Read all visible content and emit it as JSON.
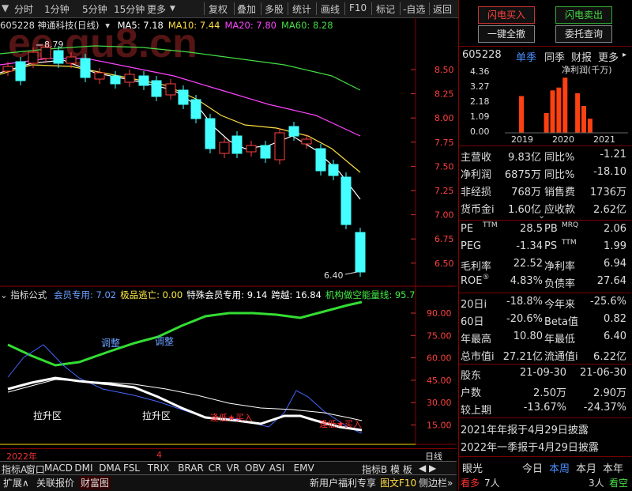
{
  "toolbar": {
    "left": [
      "分时",
      "1分钟",
      "5分钟",
      "15分钟",
      "更多"
    ],
    "right": [
      "复权",
      "叠加",
      "多股",
      "统计",
      "画线",
      "F10",
      "标记",
      "-自选",
      "返回"
    ]
  },
  "stock": {
    "header": "605228 神通科技(日线)",
    "ma": [
      {
        "label": "MA5: 7.18",
        "color": "#ffffff"
      },
      {
        "label": "MA10: 7.44",
        "color": "#ffdd44"
      },
      {
        "label": "MA20: 7.80",
        "color": "#ff44ff"
      },
      {
        "label": "MA60: 8.28",
        "color": "#44dd44"
      }
    ],
    "high_label": "8.79",
    "low_label": "6.40",
    "price_ticks": [
      "8.50",
      "8.25",
      "8.00",
      "7.75",
      "7.50",
      "7.25",
      "7.00",
      "6.75",
      "6.50"
    ]
  },
  "indicator": {
    "title": "指标公式",
    "values": [
      {
        "label": "会员专用: 7.02",
        "color": "#6aa0ff"
      },
      {
        "label": "极品逃亡: 0.00",
        "color": "#ffee44"
      },
      {
        "label": "特殊会员专用: 9.14",
        "color": "#ffffff"
      },
      {
        "label": "跨越: 16.84",
        "color": "#ffffff"
      },
      {
        "label": "机构做空能量线: 95.7",
        "color": "#44ee44"
      }
    ],
    "ticks": [
      "90.00",
      "75.00",
      "60.00",
      "45.00",
      "30.00",
      "15.00"
    ],
    "annotations": {
      "adjust1": "调整",
      "adjust2": "调整",
      "rise1": "拉升区",
      "rise2": "拉升区",
      "buy1": "逢低★买入",
      "buy2": "逢低★买入"
    }
  },
  "xaxis": {
    "year": "2022年",
    "month": "4",
    "period": "日线"
  },
  "indicator_tabs": [
    "指标A",
    "窗口",
    "MACD",
    "DMI",
    "DMA",
    "FSL",
    "TRIX",
    "BRAR",
    "CR",
    "VR",
    "OBV",
    "ASI",
    "EMV"
  ],
  "indicator_tabs_right": [
    "指标B",
    "模 板"
  ],
  "bottom_bar": {
    "expand": "扩展∧",
    "relation": "关联报价",
    "wealth": "财富图",
    "promo": "新用户福利专享",
    "f10": "图文F10",
    "side": "侧边栏»"
  },
  "right_panel": {
    "buttons": {
      "flash_buy": "闪电买入",
      "flash_sell": "闪电卖出",
      "one_key": "一键全撤",
      "order": "委托查询"
    },
    "code": "605228",
    "tabs": [
      "单季",
      "同季",
      "财报",
      "更多"
    ],
    "chart_title": "净利润(千万)",
    "chart_data": {
      "type": "bar",
      "title": "净利润(千万)",
      "yticks": [
        "4.36",
        "3.27",
        "2.18",
        "1.09",
        "0.00"
      ],
      "years": [
        "2019",
        "2020",
        "2021"
      ],
      "ylim": [
        0,
        4.36
      ],
      "values": [
        2.6,
        0,
        0,
        0,
        1.4,
        3.0,
        3.2,
        3.9,
        0,
        2.8,
        1.9,
        1.0,
        0
      ]
    },
    "fin_rows": [
      [
        "主营收",
        "9.83亿",
        "同比%",
        "-1.21"
      ],
      [
        "净利润",
        "6875万",
        "同比%",
        "-18.10"
      ],
      [
        "非经损",
        "768万",
        "销售费",
        "1736万"
      ],
      [
        "货币金i",
        "1.60亿",
        "应收款",
        "2.62亿"
      ]
    ],
    "val_rows": [
      [
        "PE",
        "TTM",
        "28.5",
        "PB",
        "MRQ",
        "2.06"
      ],
      [
        "PEG",
        "",
        "-1.34",
        "PS",
        "TTM",
        "1.99"
      ],
      [
        "毛利率",
        "",
        "22.52",
        "净利率",
        "",
        "6.94"
      ],
      [
        "ROE",
        "⑤",
        "4.83%",
        "负债率",
        "",
        "27.64"
      ]
    ],
    "perf_rows": [
      [
        "20日i",
        "-18.8%",
        "今年来",
        "-25.6%"
      ],
      [
        "60日",
        "-20.6%",
        "Beta值",
        "0.82"
      ],
      [
        "年最高",
        "10.80",
        "年最低",
        "6.40"
      ],
      [
        "总市值i",
        "27.21亿",
        "流通值i",
        "6.22亿"
      ]
    ],
    "holder_rows": [
      [
        "股东",
        "21-09-30",
        "21-06-30"
      ],
      [
        "户数",
        "2.50万",
        "2.90万"
      ],
      [
        "较上期",
        "-13.67%",
        "-24.37%"
      ]
    ],
    "notices": [
      "2021年年报于4月29日披露",
      "2022年一季报于4月29日披露"
    ],
    "eye": {
      "label": "眼光",
      "today": "今日",
      "week": "本周",
      "month": "本月",
      "year": "本年"
    },
    "bull": {
      "label": "看多",
      "count": "7人",
      "bear_count": "3人",
      "bear": "看空"
    }
  }
}
